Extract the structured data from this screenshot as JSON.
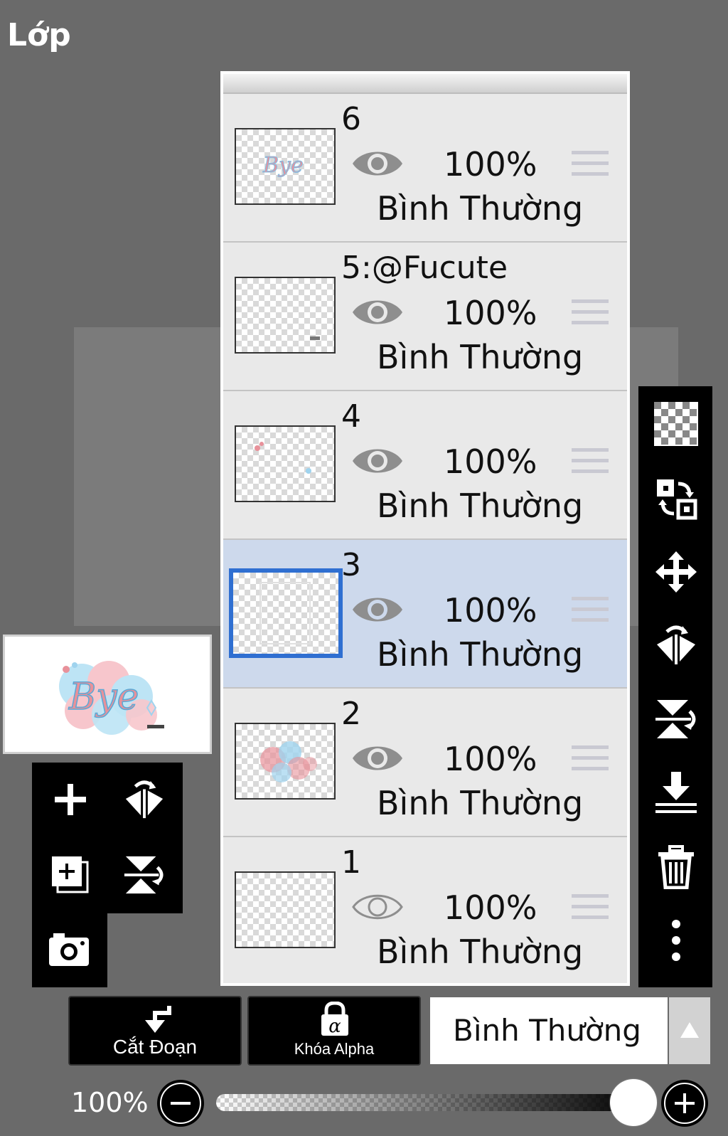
{
  "header": {
    "title": "Lớp"
  },
  "layers": [
    {
      "name": "6",
      "opacity": "100%",
      "blend_mode": "Bình Thường",
      "visible": true,
      "selected": false,
      "thumb_text": "Bye"
    },
    {
      "name": "5:@Fucute",
      "opacity": "100%",
      "blend_mode": "Bình Thường",
      "visible": true,
      "selected": false
    },
    {
      "name": "4",
      "opacity": "100%",
      "blend_mode": "Bình Thường",
      "visible": true,
      "selected": false
    },
    {
      "name": "3",
      "opacity": "100%",
      "blend_mode": "Bình Thường",
      "visible": true,
      "selected": true
    },
    {
      "name": "2",
      "opacity": "100%",
      "blend_mode": "Bình Thường",
      "visible": true,
      "selected": false
    },
    {
      "name": "1",
      "opacity": "100%",
      "blend_mode": "Bình Thường",
      "visible": false,
      "selected": false
    }
  ],
  "preview": {
    "text": "Bye"
  },
  "bottom_bar": {
    "clip_label": "Cắt Đoạn",
    "alpha_lock_label": "Khóa Alpha",
    "alpha_symbol": "α",
    "blend_mode_value": "Bình Thường"
  },
  "opacity_control": {
    "label": "100%",
    "value": 1.0
  },
  "icons": {
    "right_toolbar": [
      "transparent-bg-icon",
      "swap-layers-icon",
      "move-icon",
      "flip-horizontal-icon",
      "flip-vertical-icon",
      "merge-down-icon",
      "trash-icon",
      "more-icon"
    ],
    "left_toolbar": [
      "add-layer-icon",
      "flip-horizontal-icon",
      "add-layer-copy-icon",
      "flip-vertical-icon",
      "camera-icon"
    ]
  },
  "colors": {
    "selected_row": "#cdd9ec",
    "selected_border": "#2f6fd1"
  }
}
